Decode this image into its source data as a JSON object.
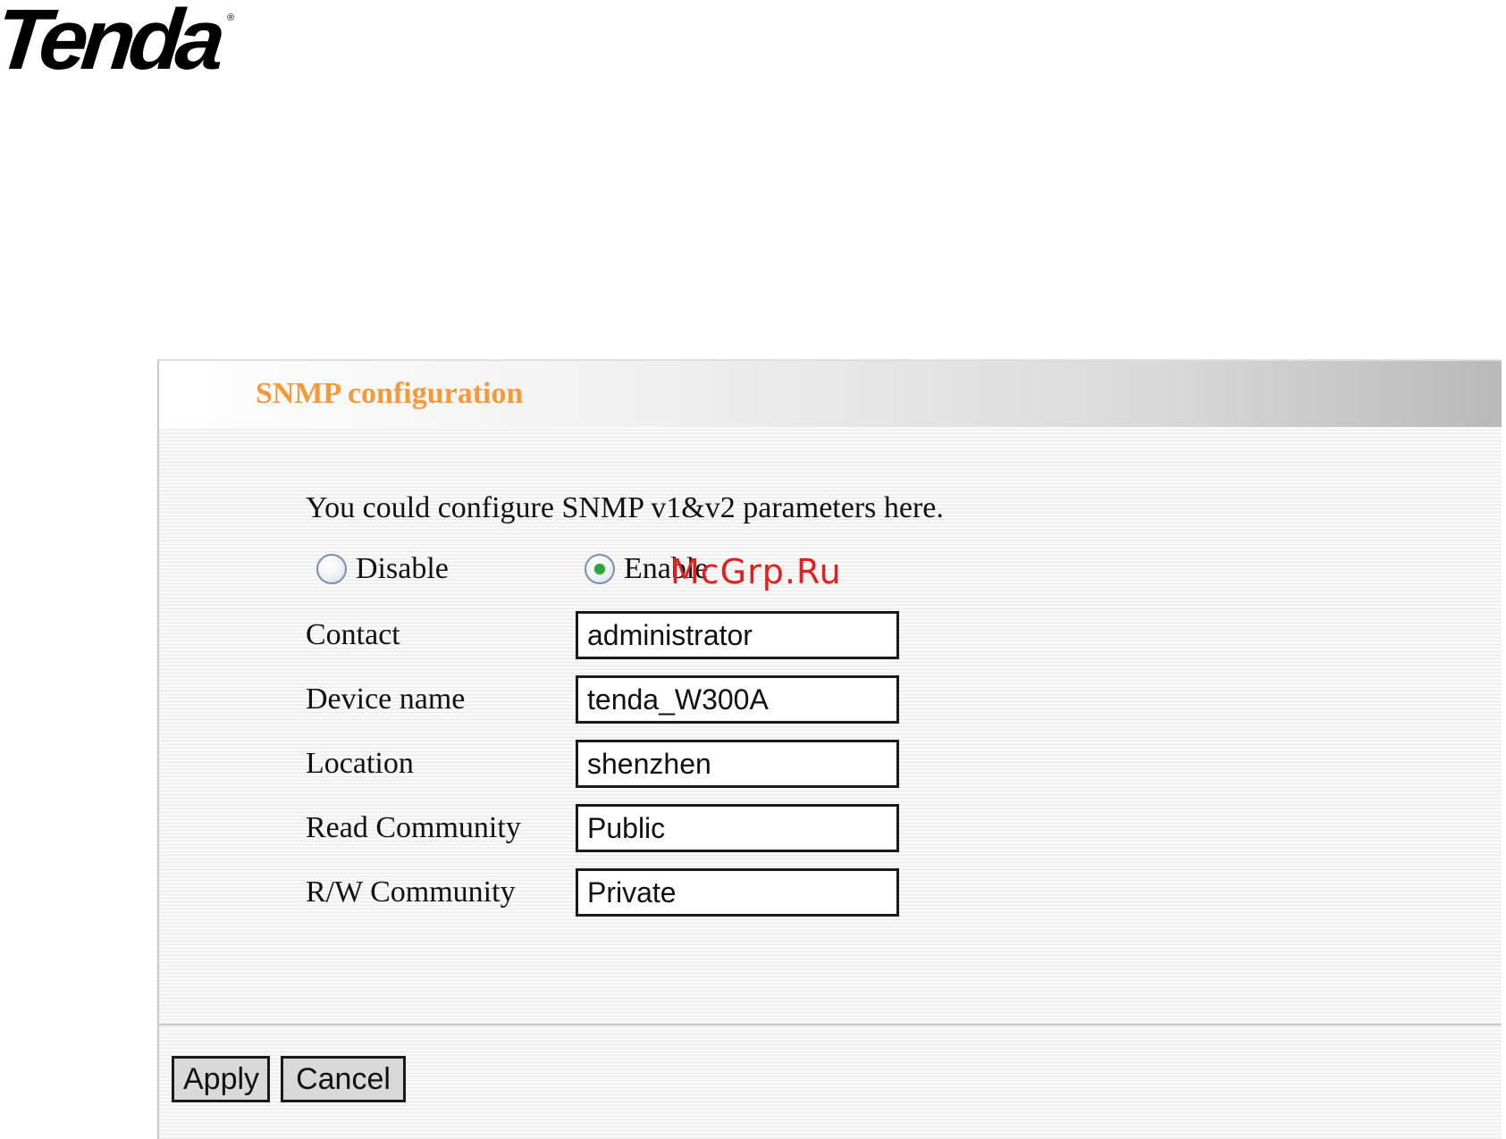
{
  "logo": {
    "brand": "Tenda",
    "mark": "®"
  },
  "panel": {
    "title": "SNMP configuration",
    "intro": "You could configure SNMP v1&v2 parameters here."
  },
  "snmp_state": {
    "options": [
      {
        "label": "Disable",
        "selected": false
      },
      {
        "label": "Enable",
        "selected": true
      }
    ]
  },
  "fields": [
    {
      "label": "Contact",
      "value": "administrator"
    },
    {
      "label": "Device name",
      "value": "tenda_W300A"
    },
    {
      "label": "Location",
      "value": "shenzhen"
    },
    {
      "label": "Read Community",
      "value": "Public"
    },
    {
      "label": "R/W Community",
      "value": "Private"
    }
  ],
  "buttons": {
    "apply": "Apply",
    "cancel": "Cancel"
  },
  "watermark": "McGrp.Ru",
  "colors": {
    "title": "#f39a3c",
    "radio_selected": "#2da33a",
    "watermark": "#e02020"
  }
}
